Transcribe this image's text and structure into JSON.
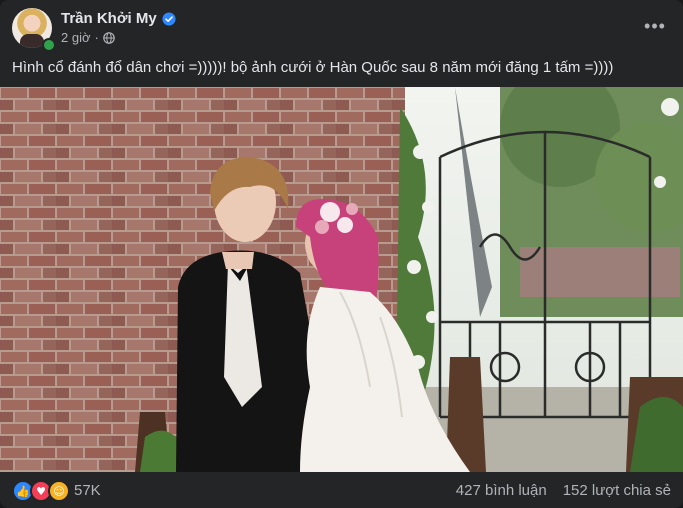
{
  "post": {
    "author_name": "Trần Khởi My",
    "timestamp": "2 giờ",
    "more_label": "•••",
    "caption": "Hình cổ đánh đổ dân chơi =)))))! bộ ảnh cưới ở Hàn Quốc sau 8 năm mới đăng 1 tấm =))))",
    "photo_icon": "wedding-photo",
    "colors": {
      "card": "#242526",
      "text": "#e4e6eb",
      "muted": "#b0b3b8",
      "verified": "#2d88ff",
      "online": "#31a24c"
    }
  },
  "footer": {
    "reaction_count": "57K",
    "comments": "427 bình luận",
    "shares": "152 lượt chia sẻ",
    "reactions": [
      "like-icon",
      "love-icon",
      "haha-icon"
    ]
  }
}
